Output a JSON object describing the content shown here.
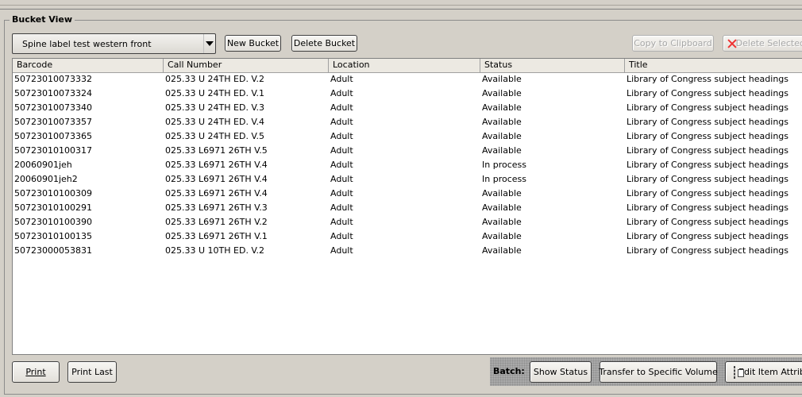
{
  "panel": {
    "title": "Bucket View"
  },
  "toolbar": {
    "bucket_selected": "Spine label test western front",
    "new_bucket": "New Bucket",
    "delete_bucket": "Delete Bucket",
    "copy_to_clipboard": "Copy to Clipboard",
    "delete_selected": "Delete Selected"
  },
  "table": {
    "columns": [
      "Barcode",
      "Call Number",
      "Location",
      "Status",
      "Title"
    ],
    "rows": [
      [
        "50723010073332",
        "025.33 U 24TH ED. V.2",
        "Adult",
        "Available",
        "Library of Congress subject headings"
      ],
      [
        "50723010073324",
        "025.33 U 24TH ED. V.1",
        "Adult",
        "Available",
        "Library of Congress subject headings"
      ],
      [
        "50723010073340",
        "025.33 U 24TH ED. V.3",
        "Adult",
        "Available",
        "Library of Congress subject headings"
      ],
      [
        "50723010073357",
        "025.33 U 24TH ED. V.4",
        "Adult",
        "Available",
        "Library of Congress subject headings"
      ],
      [
        "50723010073365",
        "025.33 U 24TH ED. V.5",
        "Adult",
        "Available",
        "Library of Congress subject headings"
      ],
      [
        "50723010100317",
        "025.33 L6971 26TH V.5",
        "Adult",
        "Available",
        "Library of Congress subject headings"
      ],
      [
        "20060901jeh",
        "025.33 L6971 26TH V.4",
        "Adult",
        "In process",
        "Library of Congress subject headings"
      ],
      [
        "20060901jeh2",
        "025.33 L6971 26TH V.4",
        "Adult",
        "In process",
        "Library of Congress subject headings"
      ],
      [
        "50723010100309",
        "025.33 L6971 26TH V.4",
        "Adult",
        "Available",
        "Library of Congress subject headings"
      ],
      [
        "50723010100291",
        "025.33 L6971 26TH V.3",
        "Adult",
        "Available",
        "Library of Congress subject headings"
      ],
      [
        "50723010100390",
        "025.33 L6971 26TH V.2",
        "Adult",
        "Available",
        "Library of Congress subject headings"
      ],
      [
        "50723010100135",
        "025.33 L6971 26TH V.1",
        "Adult",
        "Available",
        "Library of Congress subject headings"
      ],
      [
        "50723000053831",
        "025.33 U 10TH ED. V.2",
        "Adult",
        "Available",
        "Library of Congress subject headings"
      ]
    ]
  },
  "footer": {
    "print": "Print",
    "print_last": "Print Last",
    "batch_label": "Batch:",
    "show_status": "Show Status",
    "transfer": "Transfer to Specific Volume",
    "edit_item_attributes": "Edit Item Attributes"
  },
  "icons": {
    "delete": "x-icon",
    "edit": "edit-attributes-icon"
  }
}
